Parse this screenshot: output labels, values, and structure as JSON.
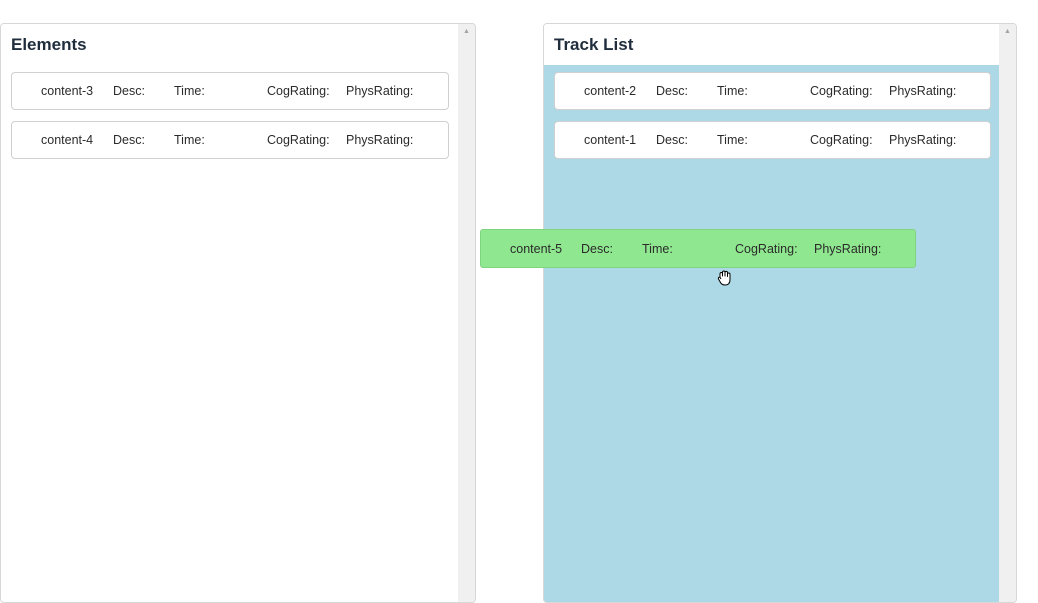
{
  "elements_panel": {
    "title": "Elements",
    "items": [
      {
        "name": "content-3",
        "desc": "Desc:",
        "time": "Time:",
        "cog": "CogRating:",
        "phys": "PhysRating:"
      },
      {
        "name": "content-4",
        "desc": "Desc:",
        "time": "Time:",
        "cog": "CogRating:",
        "phys": "PhysRating:"
      }
    ]
  },
  "track_panel": {
    "title": "Track List",
    "background": "#add8e6",
    "items": [
      {
        "name": "content-2",
        "desc": "Desc:",
        "time": "Time:",
        "cog": "CogRating:",
        "phys": "PhysRating:"
      },
      {
        "name": "content-1",
        "desc": "Desc:",
        "time": "Time:",
        "cog": "CogRating:",
        "phys": "PhysRating:"
      }
    ]
  },
  "dragged_item": {
    "name": "content-5",
    "desc": "Desc:",
    "time": "Time:",
    "cog": "CogRating:",
    "phys": "PhysRating:",
    "color": "#8fe88f"
  },
  "cursor": {
    "icon": "grab-hand-icon"
  },
  "scroll_up_glyph": "▲"
}
